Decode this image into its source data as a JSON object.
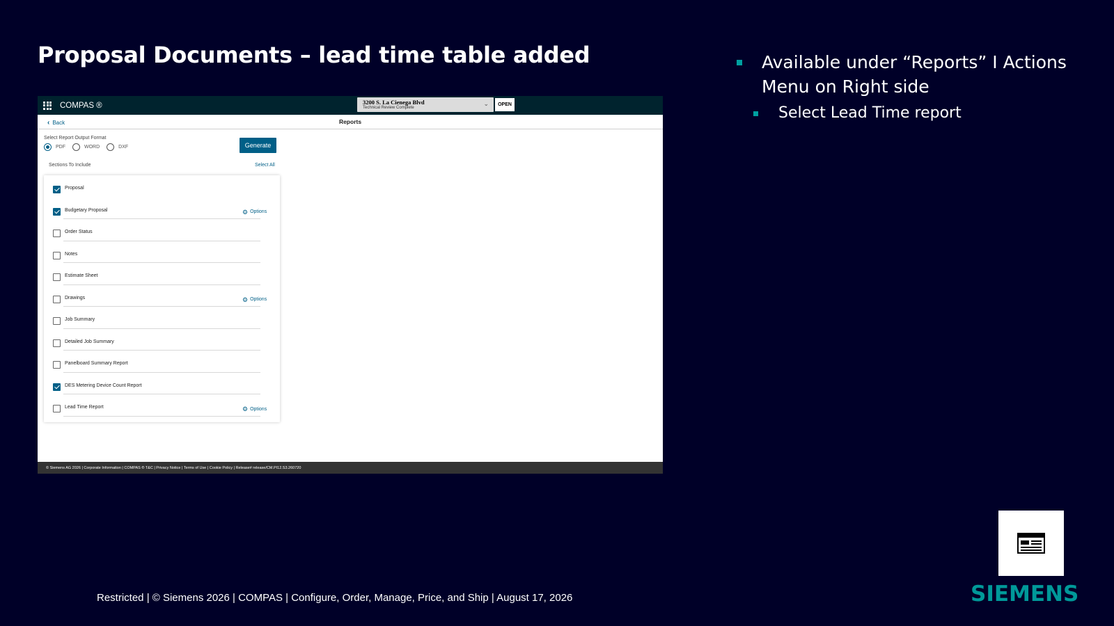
{
  "slide": {
    "title": "Proposal Documents – lead time table added",
    "bullets": [
      "Available under “Reports” I Actions Menu on Right side",
      "Select Lead Time report"
    ],
    "footer": "Restricted | © Siemens 2026 | COMPAS | Configure, Order, Manage, Price, and Ship | August 17, 2026",
    "logo": "SIEMENS"
  },
  "app": {
    "name": "COMPAS ®",
    "project": {
      "title": "3200 S. La Cienega Blvd",
      "status": "Technical Review Complete"
    },
    "open_label": "OPEN",
    "back_label": "Back",
    "page_title": "Reports",
    "format": {
      "label": "Select Report Output Format",
      "options": [
        "PDF",
        "WORD",
        "DXF"
      ],
      "selected": "PDF"
    },
    "generate_label": "Generate",
    "sections_label": "Sections To Include",
    "select_all_label": "Select All",
    "options_label": "Options",
    "sections": [
      {
        "label": "Proposal",
        "checked": true,
        "options": false
      },
      {
        "label": "Budgetary Proposal",
        "checked": true,
        "options": true
      },
      {
        "label": "Order Status",
        "checked": false,
        "options": false
      },
      {
        "label": "Notes",
        "checked": false,
        "options": false
      },
      {
        "label": "Estimate Sheet",
        "checked": false,
        "options": false
      },
      {
        "label": "Drawings",
        "checked": false,
        "options": true
      },
      {
        "label": "Job Summary",
        "checked": false,
        "options": false
      },
      {
        "label": "Detailed Job Summary",
        "checked": false,
        "options": false
      },
      {
        "label": "Panelboard Summary Report",
        "checked": false,
        "options": false
      },
      {
        "label": "DES Metering Device Count Report",
        "checked": true,
        "options": false
      },
      {
        "label": "Lead Time Report",
        "checked": false,
        "options": true
      }
    ],
    "footer": "© Siemens AG 2026 | Corporate Information | COMPAS ® T&C | Privacy Notice | Terms of Use | Cookie Policy | Release# release/CM.PI12.S3.260720"
  },
  "colors": {
    "background": "#000028",
    "accent": "#009999",
    "app_primary": "#005f87",
    "app_header": "#00232e"
  }
}
